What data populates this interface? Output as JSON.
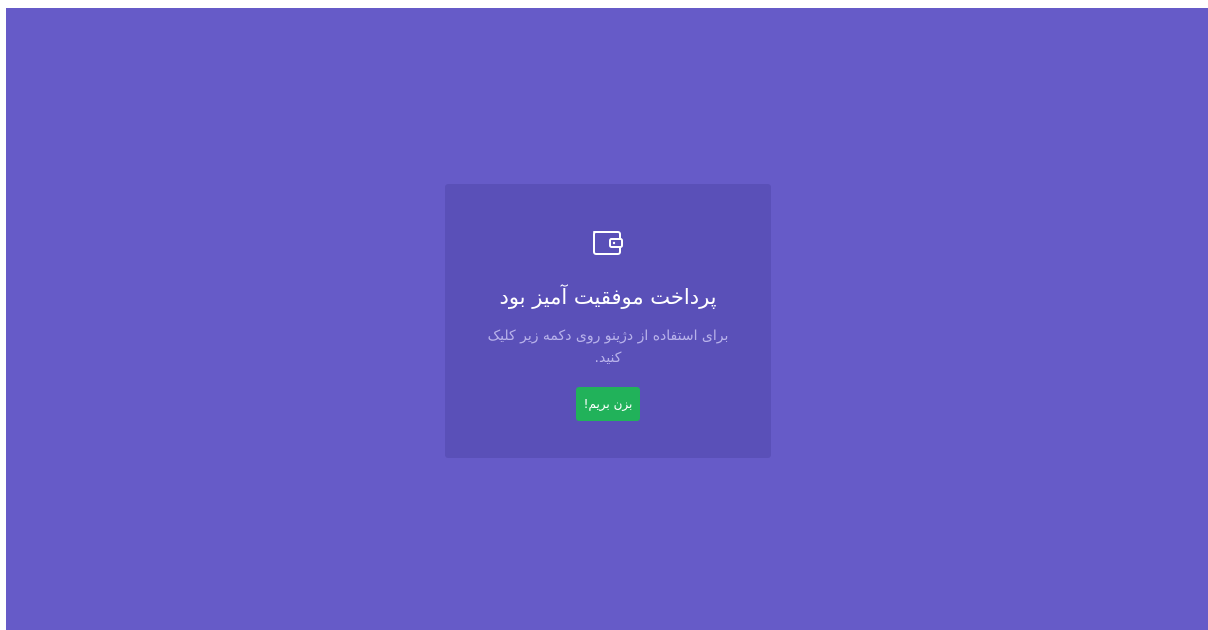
{
  "page": {
    "background_color": "#665bc8"
  },
  "card": {
    "icon": "wallet-icon",
    "title": "پرداخت موفقیت آمیز بود",
    "description": "برای استفاده از دژینو روی دکمه زیر کلیک کنید.",
    "button_label": "بزن بریم!",
    "button_color": "#21b25a"
  }
}
